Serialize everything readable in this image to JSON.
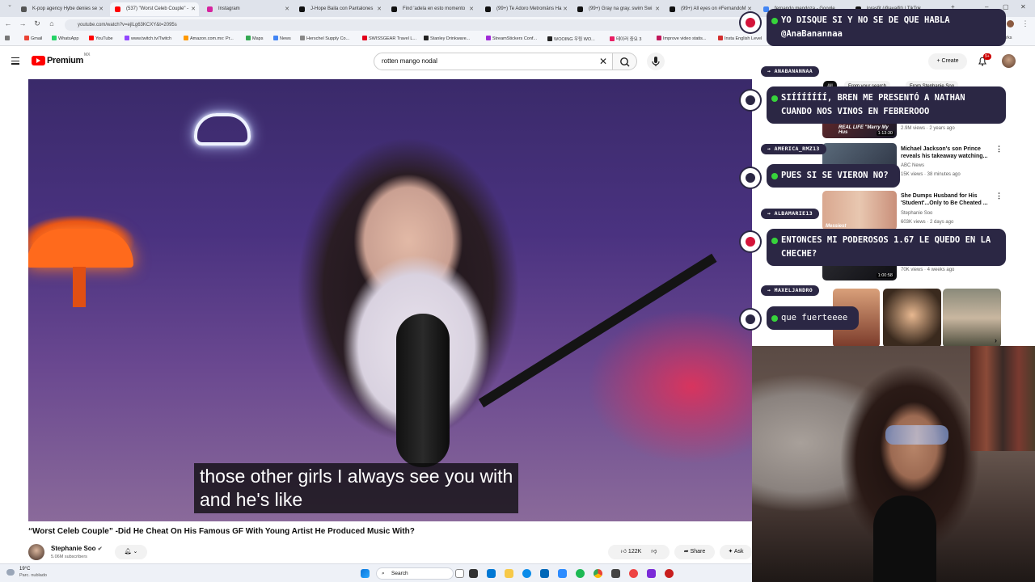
{
  "browser": {
    "tabs": [
      {
        "label": "K-pop agency Hybe denies se",
        "color": "#555555"
      },
      {
        "label": "(537) \"Worst Celeb Couple\" -",
        "color": "#ff0000",
        "active": true
      },
      {
        "label": "Instagram",
        "color": "#d6249f"
      },
      {
        "label": "J-Hope Baila con Pantalones",
        "color": "#111111"
      },
      {
        "label": "Find 'adela en esto momento",
        "color": "#111111"
      },
      {
        "label": "(99+) Te Adoro Metromäns Ha",
        "color": "#111111"
      },
      {
        "label": "(99+) Gray na gray. swim Swi",
        "color": "#111111"
      },
      {
        "label": "(99+) All eyes on #FernandoM",
        "color": "#111111"
      },
      {
        "label": "fernando mendoza - Google",
        "color": "#4285f4"
      },
      {
        "label": "lorasfit (@ayajfit) | TikTok",
        "color": "#111111"
      }
    ],
    "url": "youtube.com/watch?v=ejlLg63KCXY&t=2095s",
    "bookmarks": [
      "Gmail",
      "WhatsApp",
      "YouTube",
      "www.twitch.tv/Twitch",
      "Amazon.com.mx: Pr...",
      "Maps",
      "News",
      "Herschel Supply Co...",
      "SWISSGEAR Travel L...",
      "Stanley Drinkware...",
      "StreamStickers Conf...",
      "WOOING 우링 WO...",
      "테이러 중요 3",
      "Improve video statis...",
      "Insta English Level"
    ],
    "bookmarks_overflow": "Bookmarks"
  },
  "youtube": {
    "logo_text": "Premium",
    "country_code": "MX",
    "search_value": "rotten mango nodal",
    "create_label": "Create",
    "notif_count": "9+",
    "subtitle_lines": "those other girls I always see you with\nand he's like",
    "video_title": "“Worst Celeb Couple” -Did He Cheat On His Famous GF With Young Artist He Produced Music With?",
    "channel_name": "Stephanie Soo",
    "channel_subs": "5.06M subscribers",
    "like_count": "122K",
    "share_label": "Share",
    "ask_label": "Ask"
  },
  "sidebar": {
    "chips": [
      "All",
      "From your search",
      "From Stephanie Soo"
    ],
    "items": [
      {
        "title": "",
        "meta1": "2.9M views · 2 years ago",
        "meta2": "",
        "duration": "1:13:30",
        "thumb_text": "REAL LIFE \"Marry My Hus"
      },
      {
        "title": "Michael Jackson's son Prince reveals his takeaway watching...",
        "meta1": "ABC News",
        "meta2": "15K views · 38 minutes ago",
        "duration": "",
        "thumb_text": ""
      },
      {
        "title": "She Dumps Husband for His 'Student'...Only to Be Cheated ...",
        "meta1": "Stephanie Soo",
        "meta2": "603K views · 2 days ago",
        "duration": "",
        "thumb_text": "Messiest"
      },
      {
        "title": "",
        "meta1": "70K views · 4 weeks ago",
        "meta2": "",
        "duration": "1:00:58",
        "thumb_text": ""
      }
    ]
  },
  "chat": {
    "messages": [
      {
        "user": "",
        "text": "YO DISQUE SI Y NO SE DE QUE HABLA @AnaBanannaa"
      },
      {
        "user": "ANABANANNAA",
        "text": "SIÍÍÍÍÍÍÍ, BREN ME PRESENTÓ A NATHAN CUANDO NOS VINOS EN FEBREROOO"
      },
      {
        "user": "AMERICA_RMZ13",
        "text": "PUES SI SE VIERON NO?"
      },
      {
        "user": "ALBAMARIE13",
        "text": "ENTONCES MI PODEROSOS 1.67 LE QUEDO EN LA CHECHE?"
      },
      {
        "user": "MAXELJANDRO",
        "text": "que fuerteeee"
      }
    ],
    "user_arrow": "→"
  },
  "taskbar": {
    "weather_temp": "19°C",
    "weather_desc": "Parc. nublado",
    "search_label": "Search"
  },
  "colors": {
    "chat_bubble": "#2b2744",
    "chat_dot": "#37d43b",
    "yt_red": "#ff0000"
  }
}
